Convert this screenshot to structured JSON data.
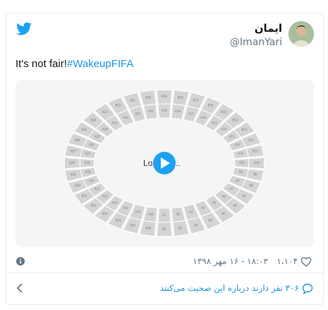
{
  "tweet": {
    "author_name": "ایمان",
    "author_handle": "@ImanYari",
    "text_plain": "It's not fair!",
    "hashtag": "#WakeupFIFA",
    "timestamp": "۱۸:۰۳ - ۱۶ مهر ۱۳۹۸",
    "like_count": "۱،۱۰۴",
    "reply_text": "۳۰۶ نفر دارند درباره این صحبت می‌کنند"
  },
  "media": {
    "loading_text": "Loading...",
    "seats_outer": [
      "B21",
      "B20",
      "B19",
      "B18",
      "B17",
      "B16",
      "B15",
      "B14",
      "B13",
      "B12",
      "B11",
      "B10",
      "B9",
      "B8",
      "B7",
      "B6",
      "B5",
      "B4",
      "B3",
      "B2",
      "B1",
      "B36",
      "B35",
      "B34",
      "B33",
      "B32",
      "B31",
      "B30",
      "B29",
      "B28",
      "B27",
      "B26",
      "B25",
      "B24",
      "B23",
      "B22"
    ],
    "seats_inner": [
      "A21",
      "A20",
      "A19",
      "A18",
      "A17",
      "A16",
      "A15",
      "A14",
      "A13",
      "A12",
      "A11",
      "A10",
      "A9",
      "A8",
      "A7",
      "A6",
      "A5",
      "A4",
      "A3",
      "A2",
      "A1",
      "A36",
      "A35",
      "A34",
      "A33",
      "A32",
      "A31",
      "A30",
      "A29",
      "A28",
      "A27",
      "A26",
      "A25",
      "A24",
      "A23",
      "A22"
    ]
  },
  "colors": {
    "brand": "#1da1f2",
    "link": "#1b95e0",
    "seat": "#d4d4d4",
    "play_button": "#1da1f2"
  },
  "icons": {
    "twitter": "twitter-bird-icon",
    "info": "info-icon",
    "like": "heart-icon",
    "reply": "speech-bubble-icon",
    "chevron": "chevron-left-icon",
    "play": "play-icon"
  }
}
